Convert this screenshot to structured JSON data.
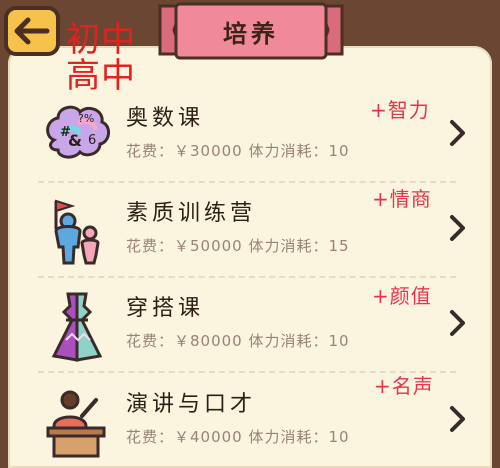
{
  "header": {
    "title": "培养",
    "overlay_line1": "初中",
    "overlay_line2": "高中"
  },
  "courses": [
    {
      "name": "奥数课",
      "cost": "花费：￥30000 体力消耗：10",
      "bonus": "+智力",
      "icon": "math-brain-icon"
    },
    {
      "name": "素质训练营",
      "cost": "花费：￥50000 体力消耗：15",
      "bonus": "+情商",
      "icon": "parent-child-flag-icon"
    },
    {
      "name": "穿搭课",
      "cost": "花费：￥80000 体力消耗：10",
      "bonus": "+颜值",
      "icon": "dress-icon"
    },
    {
      "name": "演讲与口才",
      "cost": "花费：￥40000 体力消耗：10",
      "bonus": "+名声",
      "icon": "podium-speaker-icon"
    }
  ],
  "colors": {
    "bonus": "#e8344a",
    "overlay": "#e1221f",
    "banner": "#f08a9a",
    "back_button": "#f7c24b"
  }
}
